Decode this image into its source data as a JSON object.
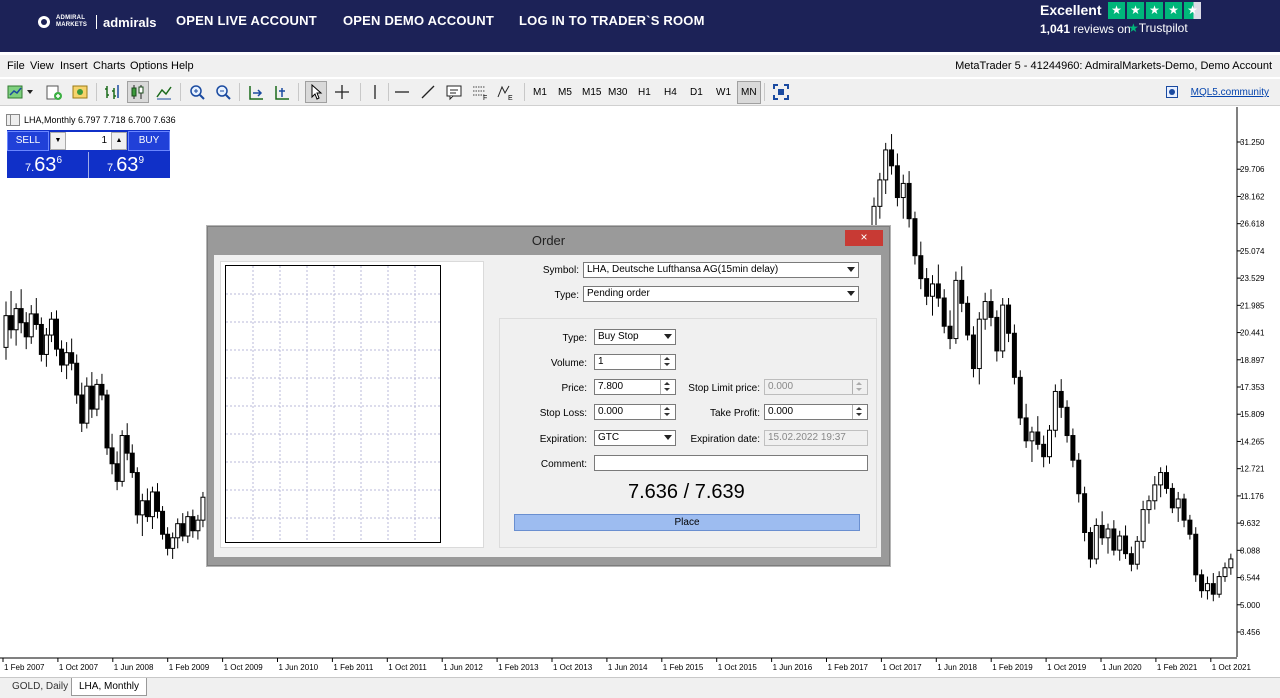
{
  "banner": {
    "logo_small": "ADMIRAL MARKETS",
    "logo_word": "admirals",
    "nav": [
      "OPEN LIVE ACCOUNT",
      "OPEN DEMO ACCOUNT",
      "LOG IN TO TRADER`S ROOM"
    ],
    "trustpilot_rating": "Excellent",
    "trustpilot_count": "1,041",
    "trustpilot_reviews_text": "reviews on",
    "trustpilot_brand": "Trustpilot",
    "stars": 4.5
  },
  "menu": {
    "items": [
      "File",
      "View",
      "Insert",
      "Charts",
      "Options",
      "Help"
    ],
    "account": "MetaTrader 5 - 41244960: AdmiralMarkets-Demo, Demo Account"
  },
  "toolbar": {
    "timeframes": [
      "M1",
      "M5",
      "M15",
      "M30",
      "H1",
      "H4",
      "D1",
      "W1",
      "MN"
    ],
    "active_timeframe": "MN",
    "community_link": "MQL5.community"
  },
  "chart": {
    "symbol_line": "LHA,Monthly  6.797 7.718 6.700 7.636",
    "price_labels": [
      "31.250",
      "29.706",
      "28.162",
      "26.618",
      "25.074",
      "23.529",
      "21.985",
      "20.441",
      "18.897",
      "17.353",
      "15.809",
      "14.265",
      "12.721",
      "11.176",
      "9.632",
      "8.088",
      "6.544",
      "5.000",
      "3.456"
    ],
    "date_labels": [
      "1 Feb 2007",
      "1 Oct 2007",
      "1 Jun 2008",
      "1 Feb 2009",
      "1 Oct 2009",
      "1 Jun 2010",
      "1 Feb 2011",
      "1 Oct 2011",
      "1 Jun 2012",
      "1 Feb 2013",
      "1 Oct 2013",
      "1 Jun 2014",
      "1 Feb 2015",
      "1 Oct 2015",
      "1 Jun 2016",
      "1 Feb 2017",
      "1 Oct 2017",
      "1 Jun 2018",
      "1 Feb 2019",
      "1 Oct 2019",
      "1 Jun 2020",
      "1 Feb 2021",
      "1 Oct 2021"
    ],
    "candles_left": [
      [
        19.6,
        22.2,
        18.9,
        21.4
      ],
      [
        21.4,
        22.8,
        20.1,
        20.6
      ],
      [
        20.6,
        22.1,
        19.7,
        21.8
      ],
      [
        21.8,
        22.9,
        20.4,
        21.0
      ],
      [
        21.0,
        21.6,
        19.5,
        20.2
      ],
      [
        20.2,
        22.0,
        19.8,
        21.5
      ],
      [
        21.5,
        22.4,
        20.6,
        20.9
      ],
      [
        20.9,
        21.3,
        18.8,
        19.2
      ],
      [
        19.2,
        20.7,
        18.5,
        20.3
      ],
      [
        20.3,
        21.6,
        19.9,
        21.2
      ],
      [
        21.2,
        21.7,
        19.1,
        19.5
      ],
      [
        19.5,
        20.0,
        18.2,
        18.6
      ],
      [
        18.6,
        19.9,
        17.8,
        19.3
      ],
      [
        19.3,
        20.1,
        18.3,
        18.7
      ],
      [
        18.7,
        19.2,
        16.4,
        16.9
      ],
      [
        16.9,
        17.6,
        14.8,
        15.3
      ],
      [
        15.3,
        17.9,
        15.0,
        17.4
      ],
      [
        17.4,
        18.2,
        15.6,
        16.1
      ],
      [
        16.1,
        17.8,
        15.7,
        17.5
      ],
      [
        17.5,
        18.1,
        16.6,
        16.9
      ],
      [
        16.9,
        17.2,
        13.5,
        13.9
      ],
      [
        13.9,
        14.7,
        12.4,
        13.0
      ],
      [
        13.0,
        13.7,
        11.5,
        12.0
      ],
      [
        12.0,
        14.9,
        11.7,
        14.6
      ],
      [
        14.6,
        15.3,
        13.2,
        13.6
      ],
      [
        13.6,
        14.1,
        12.2,
        12.5
      ],
      [
        12.5,
        12.8,
        9.6,
        10.1
      ],
      [
        10.1,
        11.3,
        8.9,
        10.9
      ],
      [
        10.9,
        11.6,
        9.7,
        10.0
      ],
      [
        10.0,
        11.7,
        9.3,
        11.4
      ],
      [
        11.4,
        11.9,
        9.9,
        10.3
      ],
      [
        10.3,
        10.6,
        8.7,
        9.0
      ],
      [
        9.0,
        9.4,
        7.8,
        8.2
      ],
      [
        8.2,
        9.1,
        7.6,
        8.8
      ],
      [
        8.8,
        9.9,
        8.2,
        9.6
      ],
      [
        9.6,
        10.2,
        8.6,
        8.9
      ],
      [
        8.9,
        10.3,
        8.5,
        10.0
      ],
      [
        10.0,
        10.4,
        8.8,
        9.2
      ],
      [
        9.2,
        10.1,
        8.7,
        9.8
      ],
      [
        9.8,
        11.4,
        9.4,
        11.1
      ]
    ],
    "candles_right": [
      [
        26.2,
        28.1,
        25.2,
        27.6
      ],
      [
        27.6,
        29.5,
        26.9,
        29.1
      ],
      [
        29.1,
        31.2,
        28.3,
        30.8
      ],
      [
        30.8,
        31.7,
        29.4,
        29.9
      ],
      [
        29.9,
        30.6,
        27.6,
        28.1
      ],
      [
        28.1,
        29.4,
        26.9,
        28.9
      ],
      [
        28.9,
        29.6,
        26.4,
        26.9
      ],
      [
        26.9,
        27.3,
        24.3,
        24.8
      ],
      [
        24.8,
        25.6,
        22.9,
        23.5
      ],
      [
        23.5,
        24.1,
        22.0,
        22.5
      ],
      [
        22.5,
        23.7,
        21.4,
        23.2
      ],
      [
        23.2,
        24.3,
        21.9,
        22.4
      ],
      [
        22.4,
        22.9,
        20.4,
        20.8
      ],
      [
        20.8,
        21.7,
        19.5,
        20.1
      ],
      [
        20.1,
        23.9,
        19.8,
        23.4
      ],
      [
        23.4,
        24.2,
        21.6,
        22.1
      ],
      [
        22.1,
        22.5,
        20.0,
        20.3
      ],
      [
        20.3,
        20.8,
        17.9,
        18.4
      ],
      [
        18.4,
        21.6,
        17.5,
        21.2
      ],
      [
        21.2,
        22.7,
        20.6,
        22.2
      ],
      [
        22.2,
        22.9,
        20.8,
        21.3
      ],
      [
        21.3,
        21.7,
        18.8,
        19.4
      ],
      [
        19.4,
        22.4,
        19.0,
        22.0
      ],
      [
        22.0,
        22.4,
        19.9,
        20.4
      ],
      [
        20.4,
        20.9,
        17.5,
        17.9
      ],
      [
        17.9,
        18.3,
        15.2,
        15.6
      ],
      [
        15.6,
        16.4,
        13.9,
        14.3
      ],
      [
        14.3,
        15.1,
        13.1,
        14.8
      ],
      [
        14.8,
        15.7,
        13.8,
        14.1
      ],
      [
        14.1,
        14.6,
        12.8,
        13.4
      ],
      [
        13.4,
        15.2,
        13.0,
        14.9
      ],
      [
        14.9,
        17.5,
        14.5,
        17.1
      ],
      [
        17.1,
        17.8,
        15.6,
        16.2
      ],
      [
        16.2,
        16.6,
        14.2,
        14.6
      ],
      [
        14.6,
        15.0,
        12.8,
        13.2
      ],
      [
        13.2,
        13.6,
        10.8,
        11.3
      ],
      [
        11.3,
        11.7,
        8.6,
        9.1
      ],
      [
        9.1,
        9.4,
        7.1,
        7.6
      ],
      [
        7.6,
        9.9,
        7.3,
        9.5
      ],
      [
        9.5,
        10.3,
        8.4,
        8.8
      ],
      [
        8.8,
        9.6,
        7.9,
        9.3
      ],
      [
        9.3,
        9.8,
        7.8,
        8.1
      ],
      [
        8.1,
        9.2,
        7.5,
        8.9
      ],
      [
        8.9,
        9.5,
        7.6,
        7.9
      ],
      [
        7.9,
        8.3,
        6.9,
        7.3
      ],
      [
        7.3,
        8.9,
        7.0,
        8.6
      ],
      [
        8.6,
        10.9,
        8.2,
        10.4
      ],
      [
        10.4,
        11.2,
        9.6,
        10.9
      ],
      [
        10.9,
        12.3,
        10.4,
        11.8
      ],
      [
        11.8,
        12.8,
        11.1,
        12.5
      ],
      [
        12.5,
        12.9,
        11.3,
        11.6
      ],
      [
        11.6,
        11.9,
        10.2,
        10.5
      ],
      [
        10.5,
        11.4,
        9.7,
        11.0
      ],
      [
        11.0,
        11.3,
        9.4,
        9.8
      ],
      [
        9.8,
        10.1,
        8.7,
        9.0
      ],
      [
        9.0,
        9.4,
        6.3,
        6.7
      ],
      [
        6.7,
        7.0,
        5.4,
        5.8
      ],
      [
        5.8,
        6.6,
        5.3,
        6.2
      ],
      [
        6.2,
        6.8,
        5.2,
        5.6
      ],
      [
        5.6,
        6.9,
        5.4,
        6.6
      ],
      [
        6.6,
        7.4,
        6.3,
        7.1
      ],
      [
        7.1,
        7.9,
        6.7,
        7.6
      ]
    ],
    "price_min": 3.456,
    "price_max": 31.25
  },
  "trade_panel": {
    "sell_label": "SELL",
    "buy_label": "BUY",
    "volume": "1",
    "sell_pre": "7.",
    "sell_mid": "63",
    "sell_sup": "6",
    "buy_pre": "7.",
    "buy_mid": "63",
    "buy_sup": "9"
  },
  "order_dialog": {
    "title": "Order",
    "close": "×",
    "symbol_label": "Symbol:",
    "symbol_value": "LHA, Deutsche Lufthansa AG(15min delay)",
    "type_label": "Type:",
    "type_value": "Pending order",
    "order_type_label": "Type:",
    "order_type_value": "Buy Stop",
    "volume_label": "Volume:",
    "volume_value": "1",
    "price_label": "Price:",
    "price_value": "7.800",
    "stop_limit_label": "Stop Limit price:",
    "stop_limit_value": "0.000",
    "stop_loss_label": "Stop Loss:",
    "stop_loss_value": "0.000",
    "take_profit_label": "Take Profit:",
    "take_profit_value": "0.000",
    "expiration_label": "Expiration:",
    "expiration_value": "GTC",
    "expiration_date_label": "Expiration date:",
    "expiration_date_value": "15.02.2022 19:37",
    "comment_label": "Comment:",
    "comment_value": "",
    "bid_ask": "7.636 / 7.639",
    "place_label": "Place"
  },
  "tabs": [
    {
      "label": "GOLD, Daily",
      "active": false
    },
    {
      "label": "LHA, Monthly",
      "active": true
    }
  ],
  "colors": {
    "banner_bg": "#1c2257",
    "trustpilot_green": "#00b67a",
    "trade_panel_blue": "#1030c8",
    "place_button": "#9dbcf0",
    "close_button": "#c83a34"
  }
}
